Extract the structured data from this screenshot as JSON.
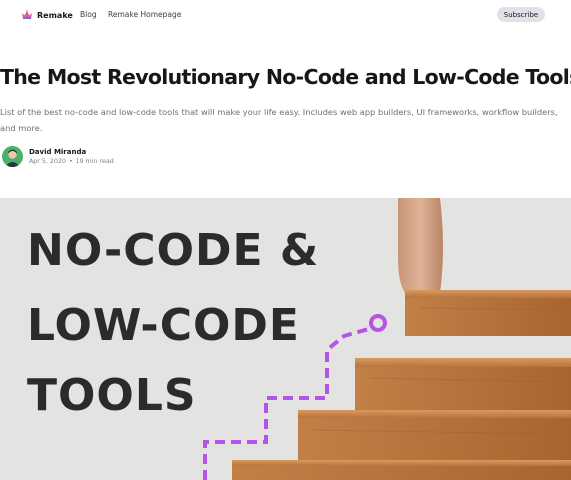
{
  "nav": {
    "brand": "Remake",
    "links": [
      "Blog",
      "Remake Homepage"
    ],
    "subscribe_label": "Subscribe"
  },
  "article": {
    "title": "The Most Revolutionary No-Code and Low-Code Tools",
    "excerpt": "List of the best no-code and low-code tools that will make your life easy. Includes web app builders, UI frameworks, workflow builders, and more.",
    "author": "David Miranda",
    "date": "Apr 5, 2020",
    "separator": "•",
    "read_time": "19 min read"
  },
  "hero": {
    "lines": [
      "NO-CODE &",
      "LOW-CODE",
      "TOOLS"
    ]
  },
  "colors": {
    "accent_purple": "#b455e6",
    "subscribe_bg": "#dfe2e6",
    "hero_bg": "#e3e3e1",
    "wood": "#c98a50"
  },
  "icons": {
    "logo": "crown-logo-icon",
    "avatar": "author-avatar"
  }
}
